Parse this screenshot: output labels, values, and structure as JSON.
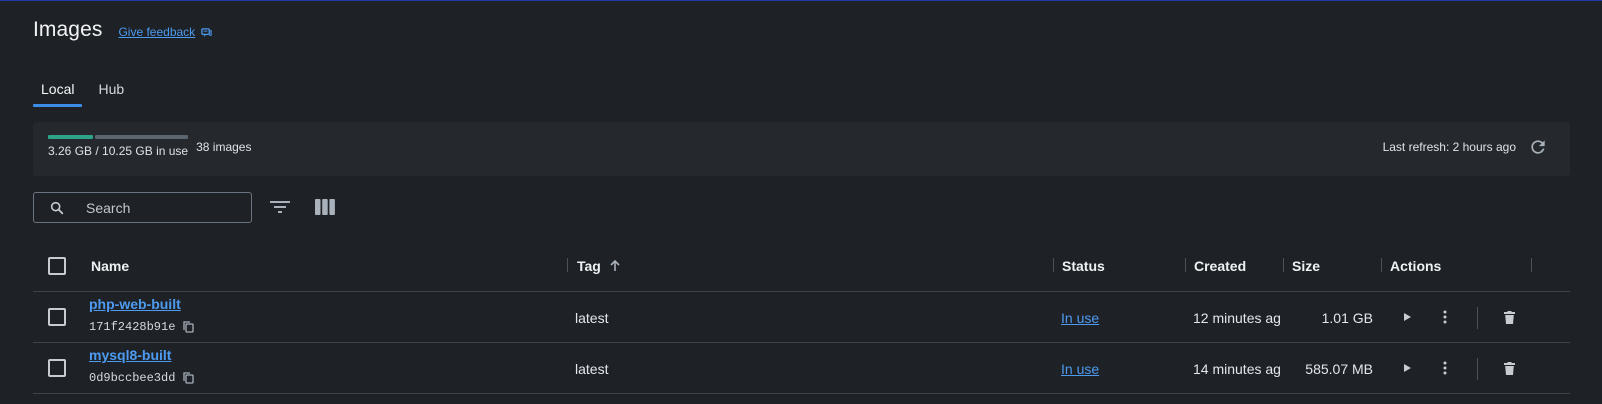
{
  "header": {
    "title": "Images",
    "feedback_label": "Give feedback"
  },
  "tabs": [
    {
      "label": "Local",
      "active": true
    },
    {
      "label": "Hub",
      "active": false
    }
  ],
  "usage": {
    "used_fraction": 0.318,
    "text": "3.26 GB / 10.25 GB in use",
    "count": "38 images",
    "last_refresh": "Last refresh: 2 hours ago"
  },
  "search": {
    "placeholder": "Search",
    "value": ""
  },
  "table": {
    "headers": {
      "name": "Name",
      "tag": "Tag",
      "status": "Status",
      "created": "Created",
      "size": "Size",
      "actions": "Actions"
    },
    "sort_column": "Tag",
    "sort_direction": "ascending",
    "rows": [
      {
        "name": "php-web-built",
        "id": "171f2428b91e",
        "tag": "latest",
        "status": "In use",
        "created": "12 minutes ag",
        "size": "1.01 GB"
      },
      {
        "name": "mysql8-built",
        "id": "0d9bccbee3dd",
        "tag": "latest",
        "status": "In use",
        "created": "14 minutes ag",
        "size": "585.07 MB"
      }
    ]
  },
  "colors": {
    "background": "#1e2227",
    "card": "#25292e",
    "accent": "#3c8de8",
    "link": "#4d9bf0",
    "usage_fill": "#2ea38a"
  },
  "icons": [
    "feedback-icon",
    "refresh-icon",
    "search-icon",
    "filter-icon",
    "columns-icon",
    "sort-ascending-icon",
    "copy-icon",
    "play-icon",
    "more-vertical-icon",
    "trash-icon"
  ]
}
